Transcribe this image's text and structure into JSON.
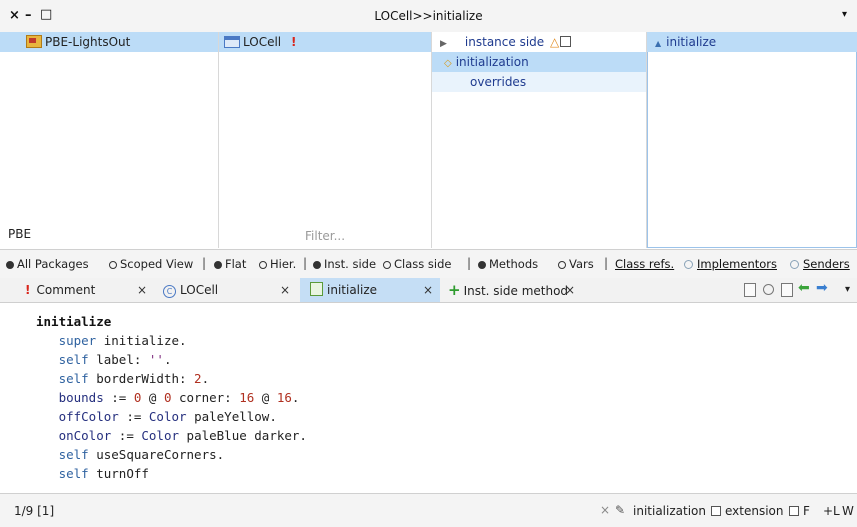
{
  "window": {
    "title": "LOCell>>initialize",
    "close_glyph": "×",
    "minimize_glyph": "–",
    "maximize_glyph": "□",
    "menu_glyph": "▾"
  },
  "packages": {
    "items": [
      "PBE-LightsOut"
    ],
    "footer": "PBE"
  },
  "classes": {
    "items": [
      "LOCell"
    ],
    "warning": "!",
    "filter_placeholder": "Filter..."
  },
  "protocols": {
    "items": [
      "instance side",
      "initialization",
      "overrides"
    ]
  },
  "methods": {
    "items": [
      "initialize"
    ]
  },
  "scope": {
    "all_packages": "All Packages",
    "scoped_view": "Scoped View",
    "flat": "Flat",
    "hier": "Hier.",
    "inst_side": "Inst. side",
    "class_side": "Class side",
    "methods": "Methods",
    "vars": "Vars",
    "class_refs": "Class refs.",
    "implementors": "Implementors",
    "senders": "Senders",
    "separator": "|"
  },
  "tabs": [
    {
      "label": "Comment",
      "close": "×"
    },
    {
      "label": "LOCell",
      "close": "×"
    },
    {
      "label": "initialize",
      "close": "×"
    },
    {
      "label": "Inst. side method",
      "close": "×"
    }
  ],
  "code": {
    "selector": "initialize",
    "lines": [
      "super initialize.",
      "self label: ''.",
      "self borderWidth: 2.",
      "bounds := 0 @ 0 corner: 16 @ 16.",
      "offColor := Color paleYellow.",
      "onColor := Color paleBlue darker.",
      "self useSquareCorners.",
      "self turnOff"
    ]
  },
  "status": {
    "position": "1/9 [1]",
    "protocol": "initialization",
    "extension": "extension",
    "format": "F",
    "line_numbers": "+L",
    "wrap": "W",
    "close": "×"
  }
}
